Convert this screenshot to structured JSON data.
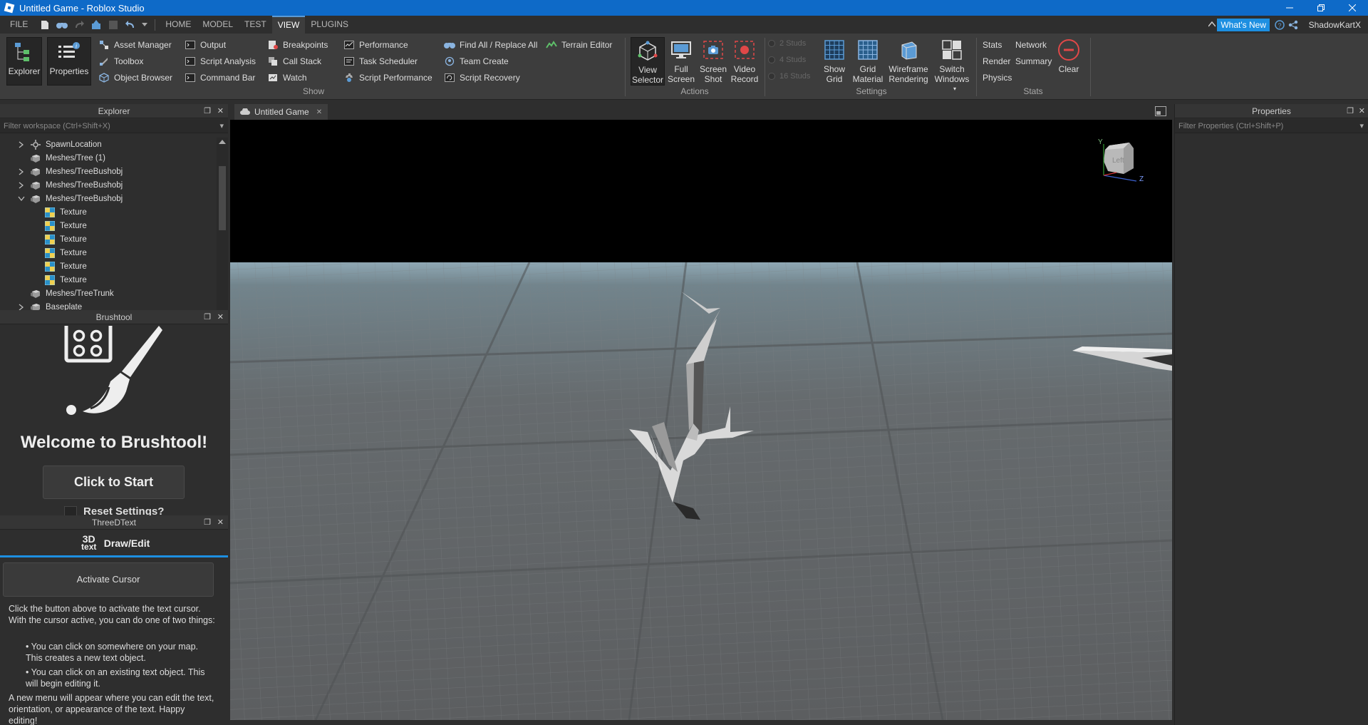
{
  "window": {
    "title": "Untitled Game - Roblox Studio",
    "controls": [
      "minimize",
      "restore",
      "close"
    ]
  },
  "menu": {
    "tabs": [
      {
        "label": "FILE"
      },
      {
        "label": "HOME"
      },
      {
        "label": "MODEL"
      },
      {
        "label": "TEST"
      },
      {
        "label": "VIEW",
        "active": true
      },
      {
        "label": "PLUGINS"
      }
    ],
    "whats_new": "What's New",
    "user": "ShadowKartX"
  },
  "ribbon": {
    "explorer": "Explorer",
    "properties": "Properties",
    "col1": [
      "Asset Manager",
      "Toolbox",
      "Object Browser"
    ],
    "col2": [
      "Output",
      "Script Analysis",
      "Command Bar"
    ],
    "col3": [
      "Breakpoints",
      "Call Stack",
      "Watch"
    ],
    "col4": [
      "Performance",
      "Task Scheduler",
      "Script Performance"
    ],
    "col5": [
      "Find All / Replace All",
      "Team Create",
      "Script Recovery"
    ],
    "terrain_editor": "Terrain Editor",
    "show_label": "Show",
    "actions": {
      "view_selector": [
        "View",
        "Selector"
      ],
      "full_screen": [
        "Full",
        "Screen"
      ],
      "screen_shot": [
        "Screen",
        "Shot"
      ],
      "video_record": [
        "Video",
        "Record"
      ],
      "label": "Actions"
    },
    "studs": [
      "2 Studs",
      "4 Studs",
      "16 Studs"
    ],
    "settings": {
      "show_grid": [
        "Show",
        "Grid"
      ],
      "grid_material": [
        "Grid",
        "Material"
      ],
      "wireframe": [
        "Wireframe",
        "Rendering"
      ],
      "switch_windows": [
        "Switch",
        "Windows"
      ],
      "label": "Settings"
    },
    "stats": {
      "items": [
        "Stats",
        "Network",
        "Render",
        "Summary",
        "Physics"
      ],
      "clear": "Clear",
      "label": "Stats"
    }
  },
  "explorer": {
    "title": "Explorer",
    "filter_placeholder": "Filter workspace (Ctrl+Shift+X)",
    "items": [
      {
        "label": "SpawnLocation",
        "indent": 0,
        "arrow": "right",
        "icon": "spawn"
      },
      {
        "label": "Meshes/Tree (1)",
        "indent": 0,
        "arrow": "none",
        "icon": "mesh"
      },
      {
        "label": "Meshes/TreeBushobj",
        "indent": 0,
        "arrow": "right",
        "icon": "mesh"
      },
      {
        "label": "Meshes/TreeBushobj",
        "indent": 0,
        "arrow": "right",
        "icon": "mesh"
      },
      {
        "label": "Meshes/TreeBushobj",
        "indent": 0,
        "arrow": "down",
        "icon": "mesh"
      },
      {
        "label": "Texture",
        "indent": 1,
        "arrow": "none",
        "icon": "texture"
      },
      {
        "label": "Texture",
        "indent": 1,
        "arrow": "none",
        "icon": "texture"
      },
      {
        "label": "Texture",
        "indent": 1,
        "arrow": "none",
        "icon": "texture"
      },
      {
        "label": "Texture",
        "indent": 1,
        "arrow": "none",
        "icon": "texture"
      },
      {
        "label": "Texture",
        "indent": 1,
        "arrow": "none",
        "icon": "texture"
      },
      {
        "label": "Texture",
        "indent": 1,
        "arrow": "none",
        "icon": "texture"
      },
      {
        "label": "Meshes/TreeTrunk",
        "indent": 0,
        "arrow": "none",
        "icon": "mesh"
      },
      {
        "label": "Baseplate",
        "indent": 0,
        "arrow": "right",
        "icon": "mesh"
      }
    ]
  },
  "brushtool": {
    "title": "Brushtool",
    "welcome": "Welcome to Brushtool!",
    "start_button": "Click to Start",
    "reset_label": "Reset Settings?"
  },
  "threedtext": {
    "title": "ThreeDText",
    "logo_top": "3D",
    "logo_bottom": "text",
    "tab_label": "Draw/Edit",
    "activate_button": "Activate Cursor",
    "intro": "Click the button above to activate the text cursor. With the cursor active, you can do one of two things:",
    "bullet1": "• You can click on somewhere on your map. This creates a new text object.",
    "bullet2": "• You can click on an existing text object. This will begin editing it.",
    "outro": "A new menu will appear where you can edit the text, orientation, or appearance of the text. Happy editing!"
  },
  "doc": {
    "tab_label": "Untitled Game"
  },
  "viewcube": {
    "face": "Left",
    "axis_y": "Y",
    "axis_z": "Z"
  },
  "properties": {
    "title": "Properties",
    "filter_placeholder": "Filter Properties (Ctrl+Shift+P)"
  }
}
